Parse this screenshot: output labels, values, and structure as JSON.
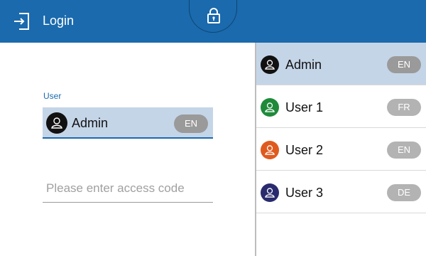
{
  "header": {
    "title": "Login",
    "login_icon": "login-icon",
    "lock_icon": "lock-icon",
    "background": "#1a6aad"
  },
  "form": {
    "user_label": "User",
    "selected_user": {
      "name": "Admin",
      "lang": "EN",
      "avatar_color": "#111111"
    },
    "access_code_placeholder": "Please enter access code"
  },
  "users": [
    {
      "name": "Admin",
      "lang": "EN",
      "avatar_color": "#111111",
      "selected": true
    },
    {
      "name": "User 1",
      "lang": "FR",
      "avatar_color": "#1f8a3a",
      "selected": false
    },
    {
      "name": "User 2",
      "lang": "EN",
      "avatar_color": "#e05a1e",
      "selected": false
    },
    {
      "name": "User 3",
      "lang": "DE",
      "avatar_color": "#2a2a6e",
      "selected": false
    }
  ],
  "colors": {
    "accent": "#1a6aad",
    "selection": "#c5d5e8",
    "badge": "#9a9a9a"
  }
}
